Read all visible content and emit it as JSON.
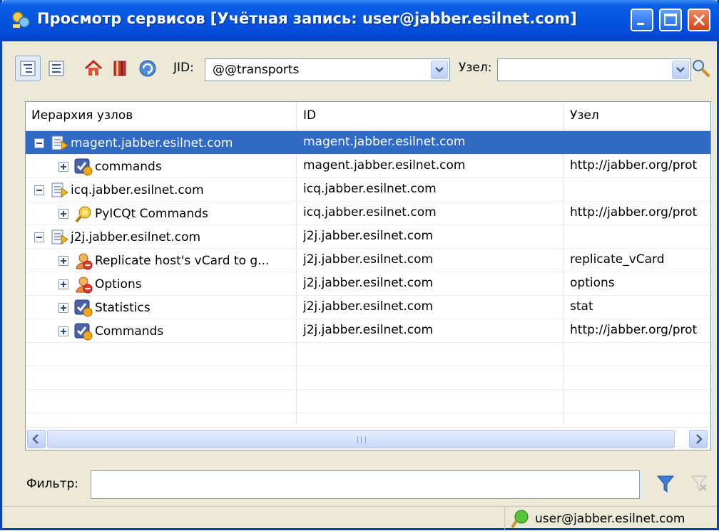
{
  "window": {
    "title": "Просмотр сервисов [Учётная запись: user@jabber.esilnet.com]"
  },
  "toolbar": {
    "jid_label": "JID:",
    "jid_value": "@@transports",
    "node_label": "Узел:",
    "node_value": ""
  },
  "table": {
    "columns": [
      "Иерархия узлов",
      "ID",
      "Узел"
    ],
    "rows": [
      {
        "name": "magent.jabber.esilnet.com",
        "id": "magent.jabber.esilnet.com",
        "node": "",
        "level": 0,
        "icon": "service-icon",
        "expander": "minus",
        "selected": true
      },
      {
        "name": "commands",
        "id": "magent.jabber.esilnet.com",
        "node": "http://jabber.org/prot",
        "level": 1,
        "icon": "commands-icon",
        "expander": "plus",
        "selected": false
      },
      {
        "name": "icq.jabber.esilnet.com",
        "id": "icq.jabber.esilnet.com",
        "node": "",
        "level": 0,
        "icon": "service-icon",
        "expander": "minus",
        "selected": false
      },
      {
        "name": "PyICQt Commands",
        "id": "icq.jabber.esilnet.com",
        "node": "http://jabber.org/prot",
        "level": 1,
        "icon": "icq-icon",
        "expander": "plus",
        "selected": false
      },
      {
        "name": "j2j.jabber.esilnet.com",
        "id": "j2j.jabber.esilnet.com",
        "node": "",
        "level": 0,
        "icon": "service-icon",
        "expander": "minus",
        "selected": false
      },
      {
        "name": "Replicate host's vCard to g...",
        "id": "j2j.jabber.esilnet.com",
        "node": "replicate_vCard",
        "level": 1,
        "icon": "user-no-icon",
        "expander": "plus",
        "selected": false
      },
      {
        "name": "Options",
        "id": "j2j.jabber.esilnet.com",
        "node": "options",
        "level": 1,
        "icon": "user-no-icon",
        "expander": "plus",
        "selected": false
      },
      {
        "name": "Statistics",
        "id": "j2j.jabber.esilnet.com",
        "node": "stat",
        "level": 1,
        "icon": "commands-icon",
        "expander": "plus",
        "selected": false
      },
      {
        "name": "Commands",
        "id": "j2j.jabber.esilnet.com",
        "node": "http://jabber.org/prot",
        "level": 1,
        "icon": "commands-icon",
        "expander": "plus",
        "selected": false
      }
    ]
  },
  "filter": {
    "label": "Фильтр:",
    "value": ""
  },
  "status": {
    "account": "user@jabber.esilnet.com"
  },
  "colors": {
    "titlebar": "#0454e0",
    "selection": "#316ac5",
    "window_bg": "#ece9d8"
  }
}
